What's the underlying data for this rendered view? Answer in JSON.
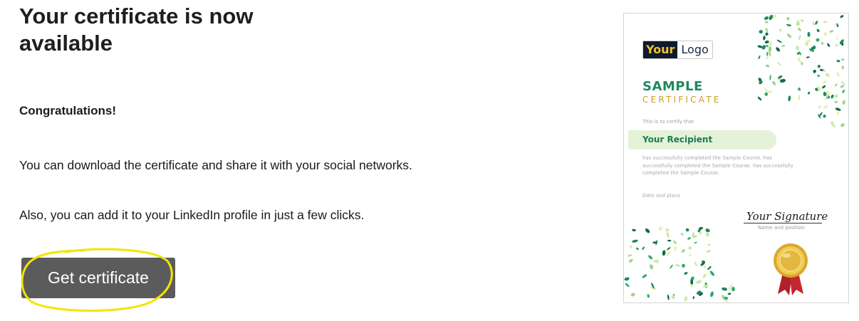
{
  "header": {
    "title": "Your certificate is now available"
  },
  "content": {
    "congrats": "Congratulations!",
    "line1": "You can download the certificate and share it with your social networks.",
    "line2": "Also, you can add it to your LinkedIn profile in just a few clicks."
  },
  "action": {
    "button_label": "Get certificate",
    "highlight_color": "#f2e600"
  },
  "certificate": {
    "logo_part1": "Your",
    "logo_part2": "Logo",
    "sample": "SAMPLE",
    "certificate_word": "CERTIFICATE",
    "certify": "This is to certify that",
    "recipient": "Your Recipient",
    "body": "has successfully completed the Sample Course. has successfully completed the Sample Course. has successfully completed the Sample Course.",
    "date_place": "Date and place",
    "signature": "Your Signature",
    "name_position": "Name and position",
    "seal_icon": "gold-seal-ribbon-icon",
    "colors": {
      "green": "#1d8a5e",
      "gold": "#c89c2c",
      "leaf_light": "#cfe8a8"
    }
  }
}
